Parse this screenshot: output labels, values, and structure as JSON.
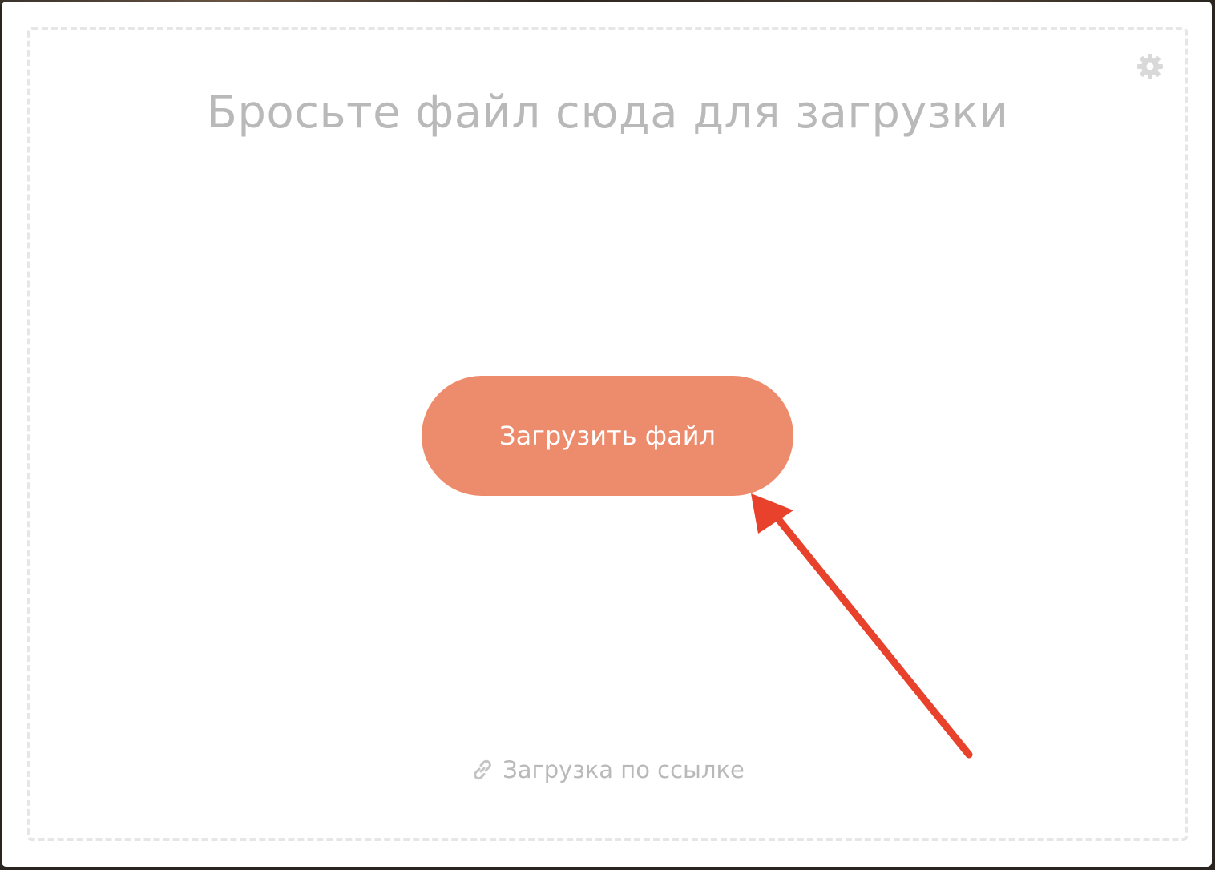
{
  "dropzone": {
    "title": "Бросьте файл сюда для загрузки",
    "settings_icon": "gear-icon"
  },
  "upload_button": {
    "label": "Загрузить файл",
    "background_color": "#ed8b6d",
    "text_color": "#ffffff"
  },
  "url_upload": {
    "icon": "link-icon",
    "label": "Загрузка по ссылке"
  },
  "annotation": {
    "type": "arrow",
    "color": "#e8412c"
  },
  "colors": {
    "muted_text": "#b9b9b9",
    "dashed_border": "#e6e6e6"
  }
}
